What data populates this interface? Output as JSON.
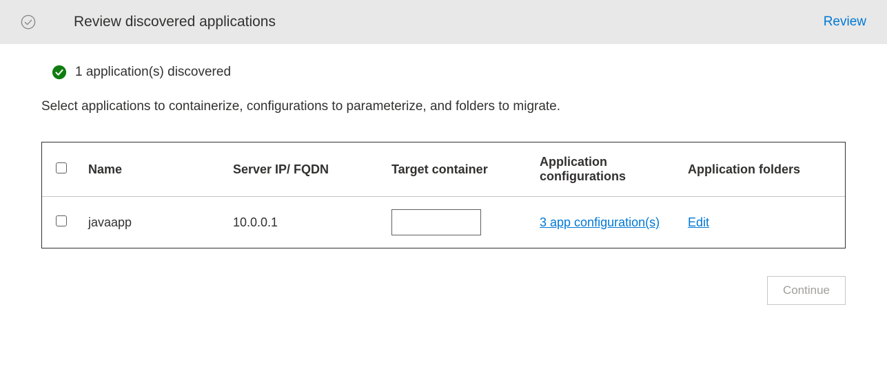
{
  "header": {
    "title": "Review discovered applications",
    "review_link": "Review"
  },
  "status": {
    "message": "1 application(s) discovered"
  },
  "description": "Select applications to containerize, configurations to parameterize, and folders to migrate.",
  "table": {
    "headers": {
      "name": "Name",
      "server": "Server IP/ FQDN",
      "target": "Target container",
      "config": "Application configurations",
      "folders": "Application folders"
    },
    "rows": [
      {
        "name": "javaapp",
        "server": "10.0.0.1",
        "target": "",
        "config_link": "3 app configuration(s)",
        "folders_link": "Edit"
      }
    ]
  },
  "footer": {
    "continue_label": "Continue"
  }
}
